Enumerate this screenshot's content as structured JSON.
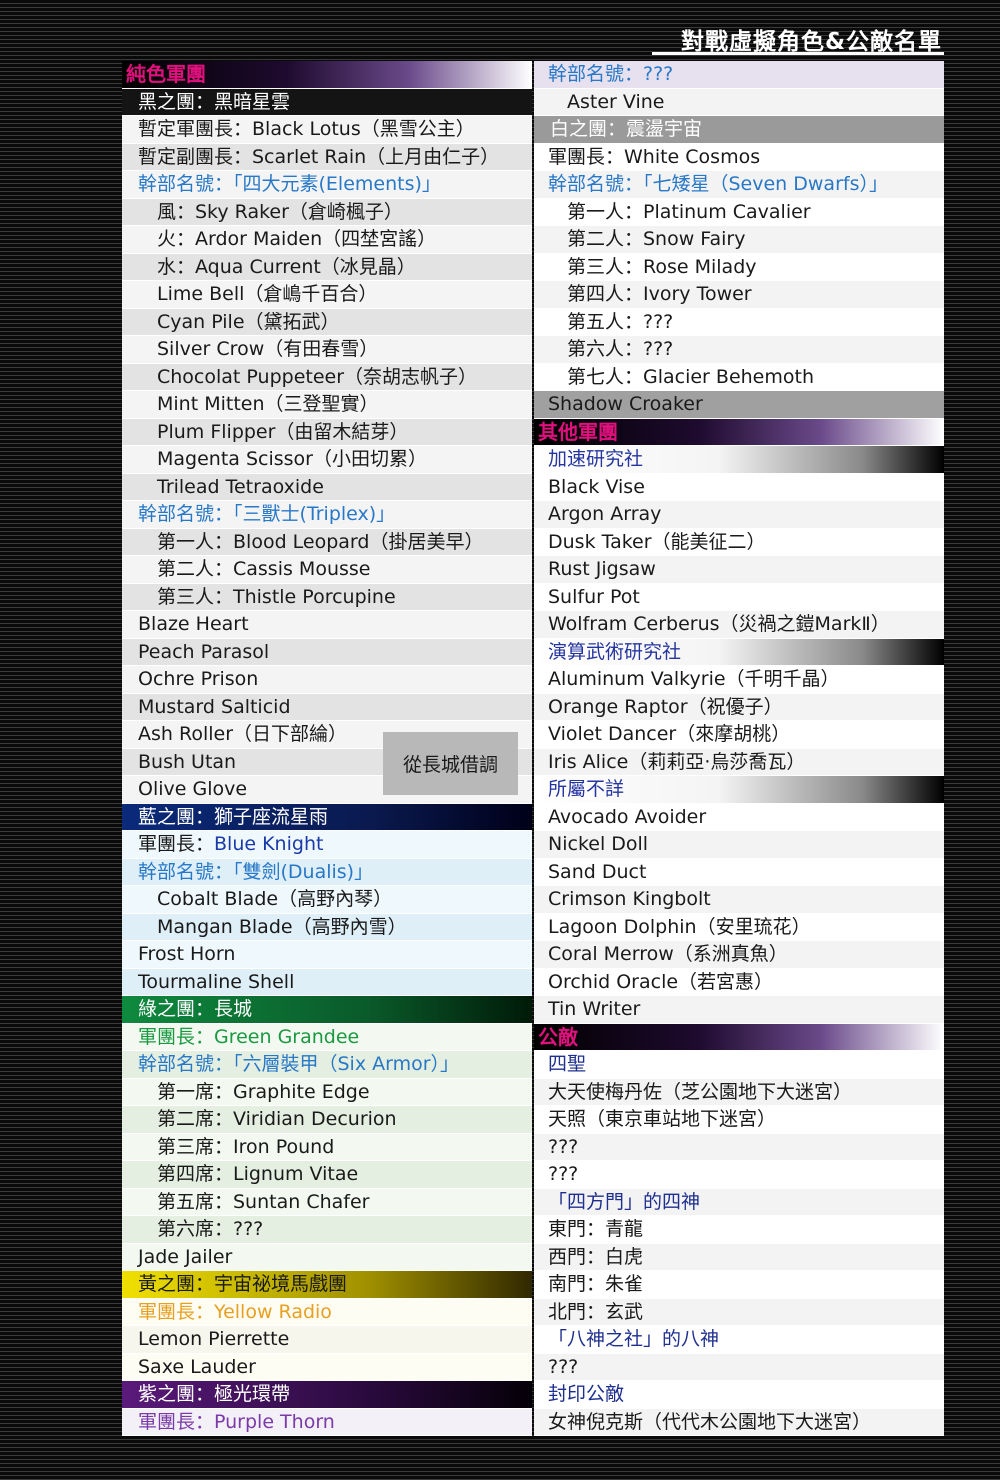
{
  "page_title": "對戰虛擬角色&公敵名單",
  "note_box": "從長城借調",
  "left": {
    "pure_color_legion": "純色軍團",
    "black": {
      "header": "黑之團：黑暗星雲",
      "leader": "暫定軍團長：Black Lotus（黑雪公主）",
      "vice": "暫定副團長：Scarlet Rain（上月由仁子）",
      "elements_title": "幹部名號：「四大元素(Elements)」",
      "members": [
        "風：Sky Raker（倉崎楓子）",
        "火：Ardor Maiden（四埜宮謠）",
        "水：Aqua Current（冰見晶）",
        "Lime Bell（倉嶋千百合）",
        "Cyan Pile（黛拓武）",
        "Silver Crow（有田春雪）",
        "Chocolat Puppeteer（奈胡志帆子）",
        "Mint Mitten（三登聖實）",
        "Plum Flipper（由留木結芽）",
        "Magenta Scissor（小田切累）",
        "Trilead Tetraoxide"
      ],
      "triplex_title": "幹部名號：「三獸士(Triplex)」",
      "triplex": [
        "第一人：Blood Leopard（掛居美早）",
        "第二人：Cassis Mousse",
        "第三人：Thistle Porcupine"
      ],
      "others": [
        "Blaze Heart",
        "Peach Parasol",
        "Ochre Prison",
        "Mustard Salticid",
        "Ash Roller（日下部綸）",
        "Bush Utan",
        "Olive Glove"
      ]
    },
    "blue": {
      "header": "藍之團：獅子座流星雨",
      "leader_prefix": "軍團長：",
      "leader_name": "Blue Knight",
      "title": "幹部名號：「雙劍(Dualis)」",
      "members": [
        "Cobalt Blade（高野內琴）",
        "Mangan Blade（高野內雪）"
      ],
      "others": [
        "Frost Horn",
        "Tourmaline Shell"
      ]
    },
    "green": {
      "header": "綠之團：長城",
      "leader": "軍團長：Green Grandee",
      "title": "幹部名號：「六層裝甲（Six Armor）」",
      "members": [
        "第一席：Graphite Edge",
        "第二席：Viridian Decurion",
        "第三席：Iron Pound",
        "第四席：Lignum Vitae",
        "第五席：Suntan Chafer",
        "第六席：???"
      ],
      "others": [
        "Jade Jailer"
      ]
    },
    "yellow": {
      "header": "黃之團：宇宙祕境馬戲團",
      "leader": "軍團長：Yellow Radio",
      "others": [
        "Lemon Pierrette",
        "Saxe Lauder"
      ]
    },
    "purple": {
      "header": "紫之團：極光環帶",
      "leader": "軍團長：Purple Thorn"
    }
  },
  "right": {
    "top_title": "幹部名號：???",
    "top_member": "Aster Vine",
    "white": {
      "header": "白之團：震盪宇宙",
      "leader": "軍團長：White Cosmos",
      "title": "幹部名號：「七矮星（Seven Dwarfs）」",
      "members": [
        "第一人：Platinum Cavalier",
        "第二人：Snow Fairy",
        "第三人：Rose Milady",
        "第四人：Ivory Tower",
        "第五人：???",
        "第六人：???",
        "第七人：Glacier Behemoth"
      ],
      "extra": "Shadow Croaker"
    },
    "other_legions": "其他軍團",
    "accel": {
      "header": "加速研究社",
      "members": [
        "Black Vise",
        "Argon Array",
        "Dusk Taker（能美征二）",
        "Rust Jigsaw",
        "Sulfur Pot",
        "Wolfram Cerberus（災禍之鎧MarkⅡ）"
      ]
    },
    "martial": {
      "header": "演算武術研究社",
      "members": [
        "Aluminum Valkyrie（千明千晶）",
        "Orange Raptor（祝優子）",
        "Violet Dancer（來摩胡桃）",
        "Iris Alice（莉莉亞·烏莎喬瓦）"
      ]
    },
    "unknown": {
      "header": "所屬不詳",
      "members": [
        "Avocado Avoider",
        "Nickel Doll",
        "Sand Duct",
        "Crimson Kingbolt",
        "Lagoon Dolphin（安里琉花）",
        "Coral Merrow（系洲真魚）",
        "Orchid Oracle（若宮惠）",
        "Tin Writer"
      ]
    },
    "enemies": "公敵",
    "four_saints": {
      "header": "四聖",
      "members": [
        "大天使梅丹佐（芝公園地下大迷宮）",
        "天照（東京車站地下迷宮）",
        "???",
        "???"
      ]
    },
    "four_gates": {
      "header": "「四方門」的四神",
      "members": [
        "東門：青龍",
        "西門：白虎",
        "南門：朱雀",
        "北門：玄武"
      ]
    },
    "eight_gods": {
      "header": "「八神之社」的八神",
      "members": [
        "???"
      ]
    },
    "sealed": {
      "header": "封印公敵",
      "members": [
        "女神倪克斯（代代木公園地下大迷宮）"
      ]
    }
  }
}
